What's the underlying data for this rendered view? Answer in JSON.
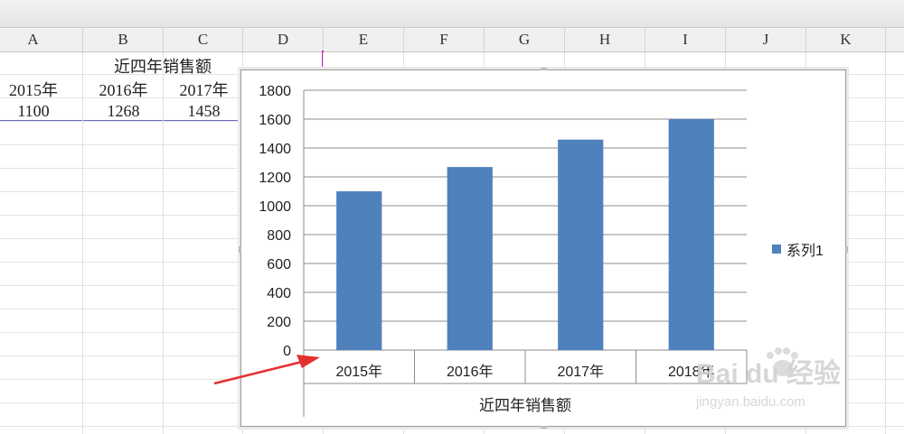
{
  "columns": [
    "A",
    "B",
    "C",
    "D",
    "E",
    "F",
    "G",
    "H",
    "I",
    "J",
    "K"
  ],
  "sheet": {
    "title": "近四年销售额",
    "years_row": [
      "2015年",
      "2016年",
      "2017年"
    ],
    "values_row": [
      "1100",
      "1268",
      "1458"
    ]
  },
  "chart_data": {
    "type": "bar",
    "categories": [
      "2015年",
      "2016年",
      "2017年",
      "2018年"
    ],
    "series": [
      {
        "name": "系列1",
        "values": [
          1100,
          1268,
          1458,
          1600
        ]
      }
    ],
    "xlabel": "近四年销售额",
    "ylabel": "",
    "ylim": [
      0,
      1800
    ],
    "yticks": [
      "0",
      "200",
      "400",
      "600",
      "800",
      "1000",
      "1200",
      "1400",
      "1600",
      "1800"
    ],
    "grid": true,
    "legend": "right",
    "color": "#4f81bd"
  },
  "watermark": {
    "brand": "Bai du 经验",
    "url": "jingyan.baidu.com"
  },
  "icons": [
    "red-arrow-annotation-icon"
  ]
}
